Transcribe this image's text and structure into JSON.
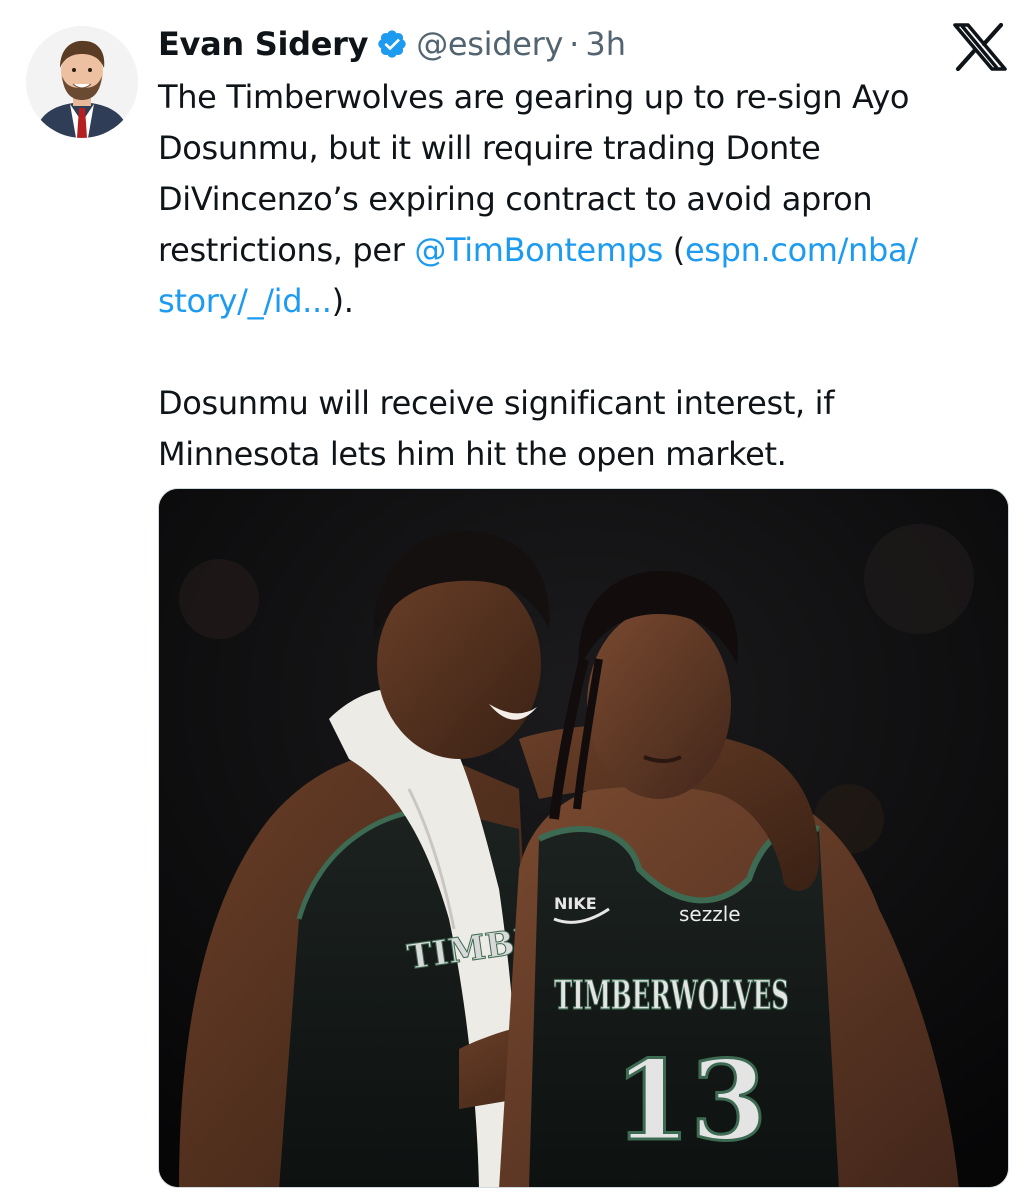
{
  "author": {
    "display_name": "Evan Sidery",
    "handle": "@esidery",
    "separator": "·",
    "time": "3h",
    "verified_icon": "verified-badge-icon"
  },
  "platform": {
    "logo_icon": "x-logo-icon"
  },
  "tweet": {
    "line1": "The Timberwolves are gearing up to re-sign Ayo",
    "line2": "Dosunmu, but it will require trading Donte",
    "line3": "DiVincenzo’s expiring contract to avoid apron",
    "line4_prefix": "restrictions, per ",
    "mention": "@TimBontemps",
    "paren_open": " (",
    "link_part1": "espn.com/nba/",
    "link_part2": "story/_/id...",
    "line5_suffix": ").",
    "para2_line1": "Dosunmu will receive significant interest, if",
    "para2_line2": "Minnesota lets him hit the open market."
  },
  "media": {
    "jersey_team": "TIMBERWOLVES",
    "jersey_number": "13",
    "jersey_sponsor": "sezzle",
    "left_jersey_team": "TIMBER",
    "brand_mark": "NIKE"
  },
  "colors": {
    "link": "#1d9bf0",
    "verified": "#1d9bf0",
    "secondary_text": "#536471"
  }
}
